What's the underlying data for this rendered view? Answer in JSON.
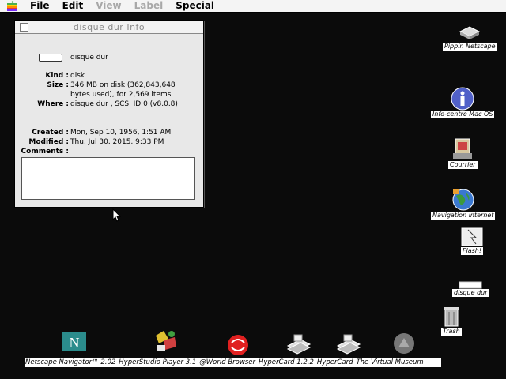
{
  "menubar": {
    "items": [
      "File",
      "Edit",
      "View",
      "Label",
      "Special"
    ],
    "disabled": [
      "View",
      "Label"
    ]
  },
  "info_window": {
    "title": "disque dur Info",
    "disk_name": "disque dur",
    "fields": [
      {
        "label": "Kind :",
        "value": "disk"
      },
      {
        "label": "Size :",
        "value": "346 MB on disk (362,843,648"
      },
      {
        "label": "",
        "value": "bytes used), for 2,569 items"
      },
      {
        "label": "Where :",
        "value": "disque dur , SCSI ID 0 (v8.0.8)"
      }
    ],
    "dates": [
      {
        "label": "Created :",
        "value": "Mon, Sep 10, 1956, 1:51 AM"
      },
      {
        "label": "Modified :",
        "value": "Thu, Jul 30, 2015, 9:33 PM"
      },
      {
        "label": "Comments :",
        "value": ""
      }
    ]
  },
  "desktop_icons": [
    {
      "label": "Pippin Netscape"
    },
    {
      "label": "Info-centre Mac OS"
    },
    {
      "label": "Courrier"
    },
    {
      "label": "Navigation internet"
    },
    {
      "label": "Flash!"
    },
    {
      "label": "disque dur"
    },
    {
      "label": "Trash"
    }
  ],
  "dock": {
    "labels": [
      "Netscape Navigator™ 2.02",
      "HyperStudio Player 3.1",
      "@World Browser",
      "HyperCard 1.2.2",
      "HyperCard",
      "The Virtual Museum"
    ]
  },
  "colors": {
    "desktop": "#0b0b0b",
    "window": "#e8e8e8"
  }
}
